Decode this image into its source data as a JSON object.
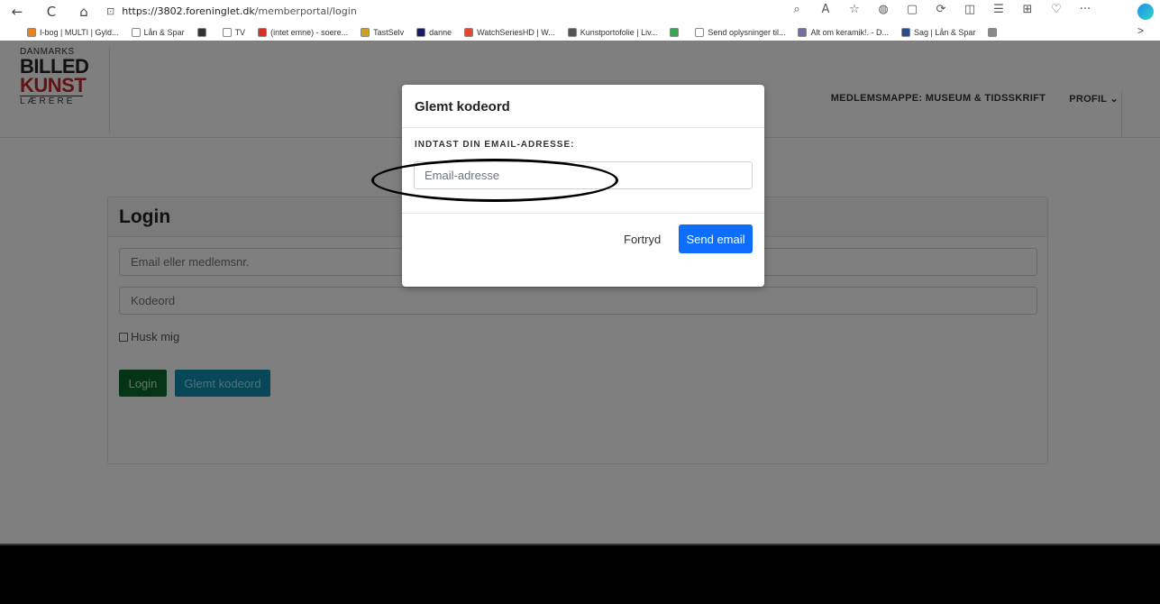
{
  "browser": {
    "url_host": "https://3802.foreninglet.dk",
    "url_path": "/memberportal/login",
    "nav": {
      "back": "←",
      "reload": "C",
      "home": "⌂"
    },
    "tool_icons": [
      "⌕",
      "A",
      "☆",
      "◍",
      "▢",
      "⟳",
      "◫",
      "☰",
      "⊞",
      "♡",
      "···"
    ],
    "favorites": [
      {
        "label": "I-bog | MULTI | Gyld...",
        "color": "#e8821e"
      },
      {
        "label": "Lån & Spar",
        "color": "#ffffff"
      },
      {
        "label": "",
        "color": "#333333"
      },
      {
        "label": "TV",
        "color": "#ffffff"
      },
      {
        "label": "(intet emne) - soere...",
        "color": "#d93025"
      },
      {
        "label": "TastSelv",
        "color": "#c9a227"
      },
      {
        "label": "danne",
        "color": "#1a1a60"
      },
      {
        "label": "WatchSeriesHD | W...",
        "color": "#e5492d"
      },
      {
        "label": "Kunstportofolie | Liv...",
        "color": "#555555"
      },
      {
        "label": "",
        "color": "#34a853"
      },
      {
        "label": "Send oplysninger til...",
        "color": "#ffffff"
      },
      {
        "label": "Alt om keramik!. - D...",
        "color": "#6f6f9e"
      },
      {
        "label": "Sag | Lån & Spar",
        "color": "#2b4c8c"
      },
      {
        "label": "",
        "color": "#888888"
      }
    ],
    "fav_more": ">"
  },
  "site": {
    "logo": {
      "line1": "DANMARKS",
      "line2": "BILLED",
      "line3": "KUNST",
      "line4": "LÆRERE"
    },
    "nav": [
      "MEDLEMSMAPPE: MUSEUM & TIDSSKRIFT",
      "PROFIL ⌄"
    ]
  },
  "login": {
    "title": "Login",
    "email_placeholder": "Email eller medlemsnr.",
    "password_placeholder": "Kodeord",
    "remember_label": "Husk mig",
    "login_button": "Login",
    "forgot_button": "Glemt kodeord"
  },
  "modal": {
    "title": "Glemt kodeord",
    "label": "INDTAST DIN EMAIL-ADRESSE:",
    "input_placeholder": "Email-adresse",
    "cancel": "Fortryd",
    "send": "Send email"
  },
  "colors": {
    "primary": "#0d6efd",
    "success": "#0b6b2c",
    "info": "#0e8fb0",
    "logo_red": "#c0282d"
  }
}
